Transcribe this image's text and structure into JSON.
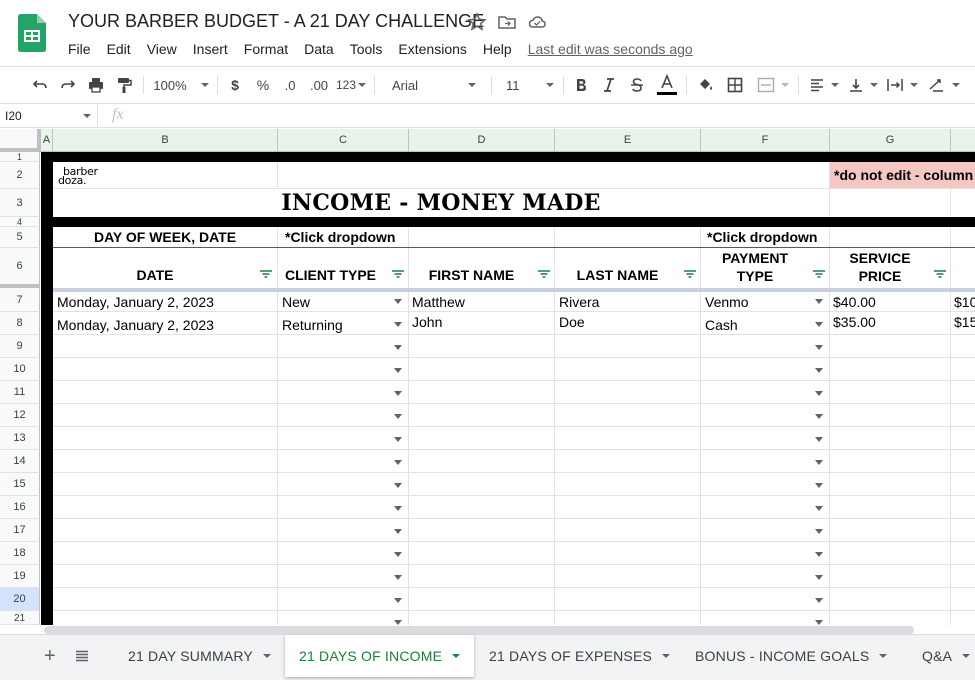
{
  "app": {
    "title": "YOUR BARBER BUDGET - A 21 DAY CHALLENGE",
    "menu": [
      "File",
      "Edit",
      "View",
      "Insert",
      "Format",
      "Data",
      "Tools",
      "Extensions",
      "Help"
    ],
    "last_edit": "Last edit was seconds ago"
  },
  "toolbar": {
    "zoom": "100%",
    "currency": "$",
    "percent": "%",
    "dec_decrease": ".0",
    "dec_increase": ".00",
    "number_format": "123",
    "font": "Arial",
    "font_size": "11"
  },
  "formula_bar": {
    "cell_ref": "I20",
    "fx": "fx"
  },
  "columns": [
    "A",
    "B",
    "C",
    "D",
    "E",
    "F",
    "G"
  ],
  "rows": [
    "1",
    "2",
    "3",
    "4",
    "5",
    "6",
    "7",
    "8",
    "9",
    "10",
    "11",
    "12",
    "13",
    "14",
    "15",
    "16",
    "17",
    "18",
    "19",
    "20",
    "21"
  ],
  "sheet": {
    "logo_line1": "barber",
    "logo_line2": "doza.",
    "warning": "*do not edit - column",
    "heading": "INCOME - MONEY MADE",
    "row5": {
      "b": "DAY OF WEEK, DATE",
      "c": "*Click dropdown",
      "f": "*Click dropdown"
    },
    "headers": {
      "date": "DATE",
      "client_type": "CLIENT TYPE",
      "first_name": "FIRST NAME",
      "last_name": "LAST NAME",
      "payment_type_1": "PAYMENT",
      "payment_type_2": "TYPE",
      "service_price_1": "SERVICE",
      "service_price_2": "PRICE"
    },
    "entries": [
      {
        "date": "Monday, January 2, 2023",
        "client_type": "New",
        "first_name": "Matthew",
        "last_name": "Rivera",
        "payment_type": "Venmo",
        "service_price": "$40.00",
        "h_partial": "$10"
      },
      {
        "date": "Monday, January 2, 2023",
        "client_type": "Returning",
        "first_name": "John",
        "last_name": "Doe",
        "payment_type": "Cash",
        "service_price": "$35.00",
        "h_partial": "$15"
      }
    ]
  },
  "tabs": {
    "add": "+",
    "items": [
      "21 DAY SUMMARY",
      "21 DAYS OF INCOME",
      "21 DAYS OF EXPENSES",
      "BONUS - INCOME GOALS",
      "Q&A"
    ],
    "active": "21 DAYS OF INCOME"
  },
  "colors": {
    "sheets_green": "#188038",
    "header_green": "#e6f4ea",
    "warning_bg": "#f4c7c3",
    "selected_row": "#d3e3fd"
  }
}
